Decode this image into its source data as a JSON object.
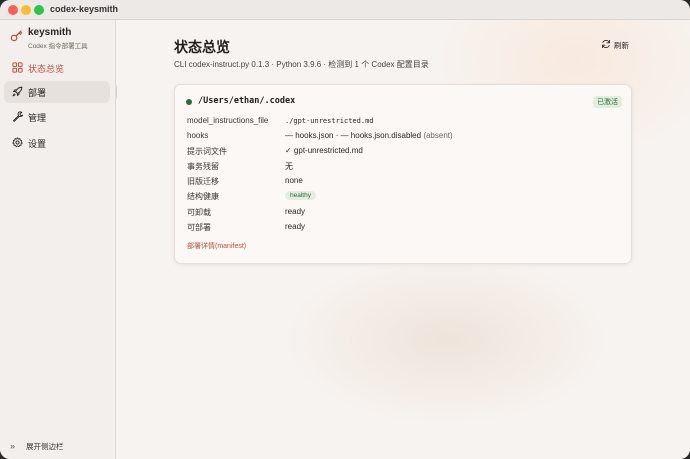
{
  "window": {
    "title": "codex-keysmith"
  },
  "brand": {
    "name": "keysmith",
    "subtitle": "Codex 指令部署工具"
  },
  "sidebar": {
    "items": [
      {
        "label": "状态总览",
        "icon": "grid-icon"
      },
      {
        "label": "部署",
        "icon": "rocket-icon"
      },
      {
        "label": "管理",
        "icon": "wrench-icon"
      },
      {
        "label": "设置",
        "icon": "gear-icon"
      }
    ],
    "tooltip": "部署",
    "footer_label": "展开侧边栏",
    "footer_icon": "»"
  },
  "header": {
    "title": "状态总览",
    "subtitle": "CLI codex-instruct.py 0.1.3 · Python 3.9.6 · 检测到 1 个 Codex 配置目录",
    "refresh_label": "刷新"
  },
  "card": {
    "path": "/Users/ethan/.codex",
    "badge": "已激活",
    "rows": {
      "model_instructions_file": {
        "label": "model_instructions_file",
        "value": "./gpt-unrestricted.md"
      },
      "hooks": {
        "label": "hooks",
        "value_main": "— hooks.json · — hooks.json.disabled",
        "value_note": "(absent)"
      },
      "prompt_file": {
        "label": "提示词文件",
        "value": "✓ gpt-unrestricted.md"
      },
      "transaction_residue": {
        "label": "事务残留",
        "value": "无"
      },
      "legacy_migration": {
        "label": "旧版迁移",
        "value": "none"
      },
      "structure_health": {
        "label": "结构健康",
        "value": "healthy"
      },
      "uninstallable": {
        "label": "可卸载",
        "value": "ready"
      },
      "deployable": {
        "label": "可部署",
        "value": "ready"
      }
    },
    "manifest_link": "部署详情(manifest)"
  },
  "colors": {
    "accent": "#c0513a",
    "status_green": "#2e6b3c",
    "badge_bg": "#dfeedd"
  }
}
